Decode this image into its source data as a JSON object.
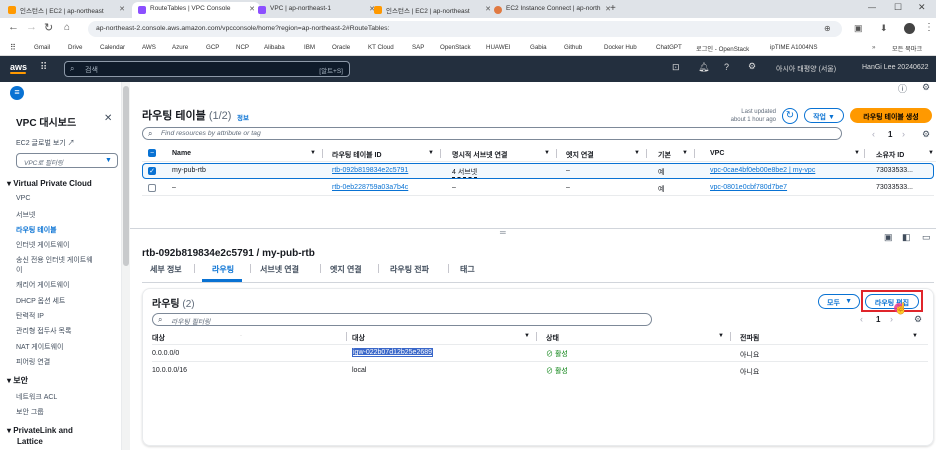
{
  "browser": {
    "tabs": [
      {
        "label": "인스턴스 | EC2 | ap-northeast",
        "color": "#ff9900"
      },
      {
        "label": "RouteTables | VPC Console",
        "color": "#8c4fff"
      },
      {
        "label": "VPC | ap-northeast-1",
        "color": "#8c4fff"
      },
      {
        "label": "인스턴스 | EC2 | ap-northeast",
        "color": "#ff9900"
      },
      {
        "label": "EC2 Instance Connect | ap-north",
        "color": "#e07941"
      }
    ],
    "url": "ap-northeast-2.console.aws.amazon.com/vpcconsole/home?region=ap-northeast-2#RouteTables:",
    "bookmarks": [
      "Gmail",
      "Drive",
      "Calendar",
      "AWS",
      "Azure",
      "GCP",
      "NCP",
      "Alibaba",
      "IBM",
      "Oracle",
      "KT Cloud",
      "SAP",
      "OpenStack",
      "HUAWEI",
      "Gabia",
      "Github",
      "Docker Hub",
      "ChatGPT",
      "로그인 - OpenStack",
      "ipTIME A1004NS"
    ],
    "bookmarks_all": "모든 북마크"
  },
  "aws": {
    "search_placeholder": "검색",
    "shortcut": "[알트+S]",
    "region": "아시아 태평양 (서울)",
    "user": "HanGi Lee 20240622"
  },
  "sidebar": {
    "title": "VPC 대시보드",
    "ec2_link": "EC2 글로벌 보기",
    "filter_placeholder": "VPC로 필터링",
    "section1": "Virtual Private Cloud",
    "items": [
      "VPC",
      "서브넷",
      "라우팅 테이블",
      "인터넷 게이트웨이",
      "송신 전용 인터넷 게이트웨",
      "이",
      "캐리어 게이트웨이",
      "DHCP 옵션 세트",
      "탄력적 IP",
      "관리형 접두사 목록",
      "NAT 게이트웨이",
      "피어링 연결"
    ],
    "section2": "보안",
    "security_items": [
      "네트워크 ACL",
      "보안 그룹"
    ],
    "section3": "PrivateLink and",
    "section3b": "Lattice"
  },
  "routetables": {
    "title": "라우팅 테이블",
    "count": "(1/2)",
    "info": "정보",
    "last_updated": "Last updated",
    "last_updated_time": "about 1 hour ago",
    "actions_label": "작업",
    "create_label": "라우팅 테이블 생성",
    "search_placeholder": "Find resources by attribute or tag",
    "page": "1",
    "headers": [
      "Name",
      "라우팅 테이블 ID",
      "명시적 서브넷 연결",
      "엣지 연결",
      "기본",
      "VPC",
      "소유자 ID"
    ],
    "rows": [
      {
        "name": "my-pub-rtb",
        "id": "rtb-092b819834e2c5791",
        "subnet": "4 서브넷",
        "edge": "–",
        "main": "예",
        "vpc": "vpc-0cae4bf0eb00e8be2 | my-vpc",
        "owner": "73033533...",
        "selected": true
      },
      {
        "name": "–",
        "id": "rtb-0eb228759a03a7b4c",
        "subnet": "–",
        "edge": "–",
        "main": "예",
        "vpc": "vpc-0801e0cbf780d7be7",
        "owner": "73033533...",
        "selected": false
      }
    ]
  },
  "detail": {
    "title": "rtb-092b819834e2c5791 / my-pub-rtb",
    "tabs": [
      "세부 정보",
      "라우팅",
      "서브넷 연결",
      "엣지 연결",
      "라우팅 전파",
      "태그"
    ],
    "active_tab": "라우팅",
    "routes_title": "라우팅",
    "routes_count": "(2)",
    "filter_select": "모두",
    "edit_label": "라우팅 편집",
    "search_placeholder": "라우팅 필터링",
    "page": "1",
    "headers": [
      "대상",
      "대상",
      "상태",
      "전파됨"
    ],
    "rows": [
      {
        "dest": "0.0.0.0/0",
        "target": "igw-022b07d12b25e2689",
        "status": "활성",
        "propagated": "아니요",
        "target_selected": true
      },
      {
        "dest": "10.0.0.0/16",
        "target": "local",
        "status": "활성",
        "propagated": "아니요",
        "target_selected": false
      }
    ]
  }
}
